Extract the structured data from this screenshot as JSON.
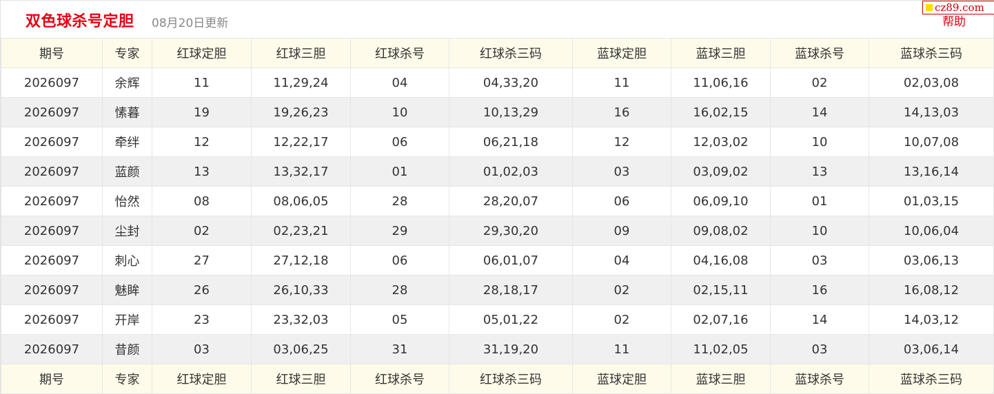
{
  "header": {
    "title": "双色球杀号定胆",
    "update": "08月20日更新",
    "watermark": "cz89.com",
    "help": "帮助"
  },
  "columns": [
    "期号",
    "专家",
    "红球定胆",
    "红球三胆",
    "红球杀号",
    "红球杀三码",
    "蓝球定胆",
    "蓝球三胆",
    "蓝球杀号",
    "蓝球杀三码"
  ],
  "rows": [
    [
      "2026097",
      "余辉",
      "11",
      "11,29,24",
      "04",
      "04,33,20",
      "11",
      "11,06,16",
      "02",
      "02,03,08"
    ],
    [
      "2026097",
      "愫暮",
      "19",
      "19,26,23",
      "10",
      "10,13,29",
      "16",
      "16,02,15",
      "14",
      "14,13,03"
    ],
    [
      "2026097",
      "牵绊",
      "12",
      "12,22,17",
      "06",
      "06,21,18",
      "12",
      "12,03,02",
      "10",
      "10,07,08"
    ],
    [
      "2026097",
      "蓝颜",
      "13",
      "13,32,17",
      "01",
      "01,02,03",
      "03",
      "03,09,02",
      "13",
      "13,16,14"
    ],
    [
      "2026097",
      "怡然",
      "08",
      "08,06,05",
      "28",
      "28,20,07",
      "06",
      "06,09,10",
      "01",
      "01,03,15"
    ],
    [
      "2026097",
      "尘封",
      "02",
      "02,23,21",
      "29",
      "29,30,20",
      "09",
      "09,08,02",
      "10",
      "10,06,04"
    ],
    [
      "2026097",
      "刺心",
      "27",
      "27,12,18",
      "06",
      "06,01,07",
      "04",
      "04,16,08",
      "03",
      "03,06,13"
    ],
    [
      "2026097",
      "魅眸",
      "26",
      "26,10,33",
      "28",
      "28,18,17",
      "02",
      "02,15,11",
      "16",
      "16,08,12"
    ],
    [
      "2026097",
      "开岸",
      "23",
      "23,32,03",
      "05",
      "05,01,22",
      "02",
      "02,07,16",
      "14",
      "14,03,12"
    ],
    [
      "2026097",
      "昔颜",
      "03",
      "03,06,25",
      "31",
      "31,19,20",
      "11",
      "11,02,05",
      "03",
      "03,06,14"
    ]
  ]
}
